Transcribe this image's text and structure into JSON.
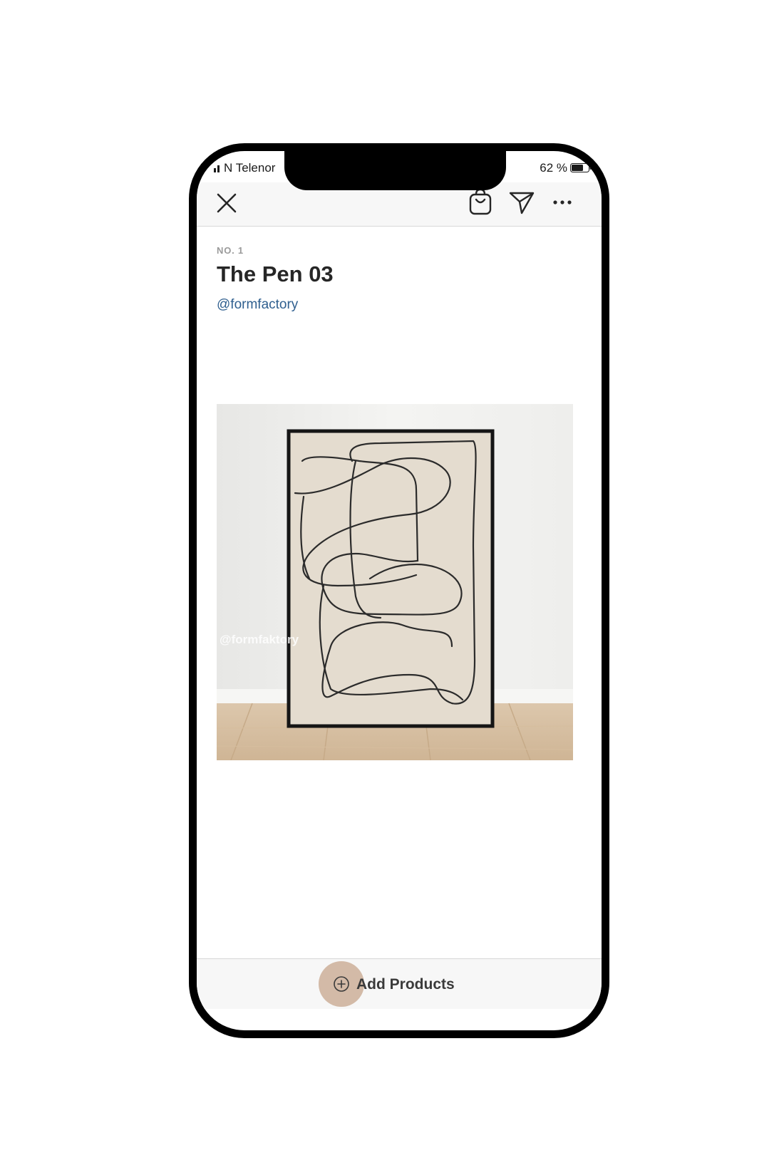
{
  "status_bar": {
    "carrier": "N Telenor",
    "battery": "62 %",
    "signal_icon": "signal-icon",
    "battery_icon": "battery-icon"
  },
  "toolbar": {
    "close_icon": "close-icon",
    "bag_icon": "shopping-bag-icon",
    "send_icon": "send-icon",
    "more_icon": "more-icon"
  },
  "post": {
    "number": "NO. 1",
    "title": "The Pen 03",
    "handle": "@formfactory",
    "image_watermark": "@formfaktory"
  },
  "footer": {
    "add_products_label": "Add Products",
    "add_icon": "plus-circle-icon"
  },
  "colors": {
    "handle_link": "#2f5f8f",
    "tap_highlight": "#c7a58c",
    "frame_border": "#000000"
  }
}
